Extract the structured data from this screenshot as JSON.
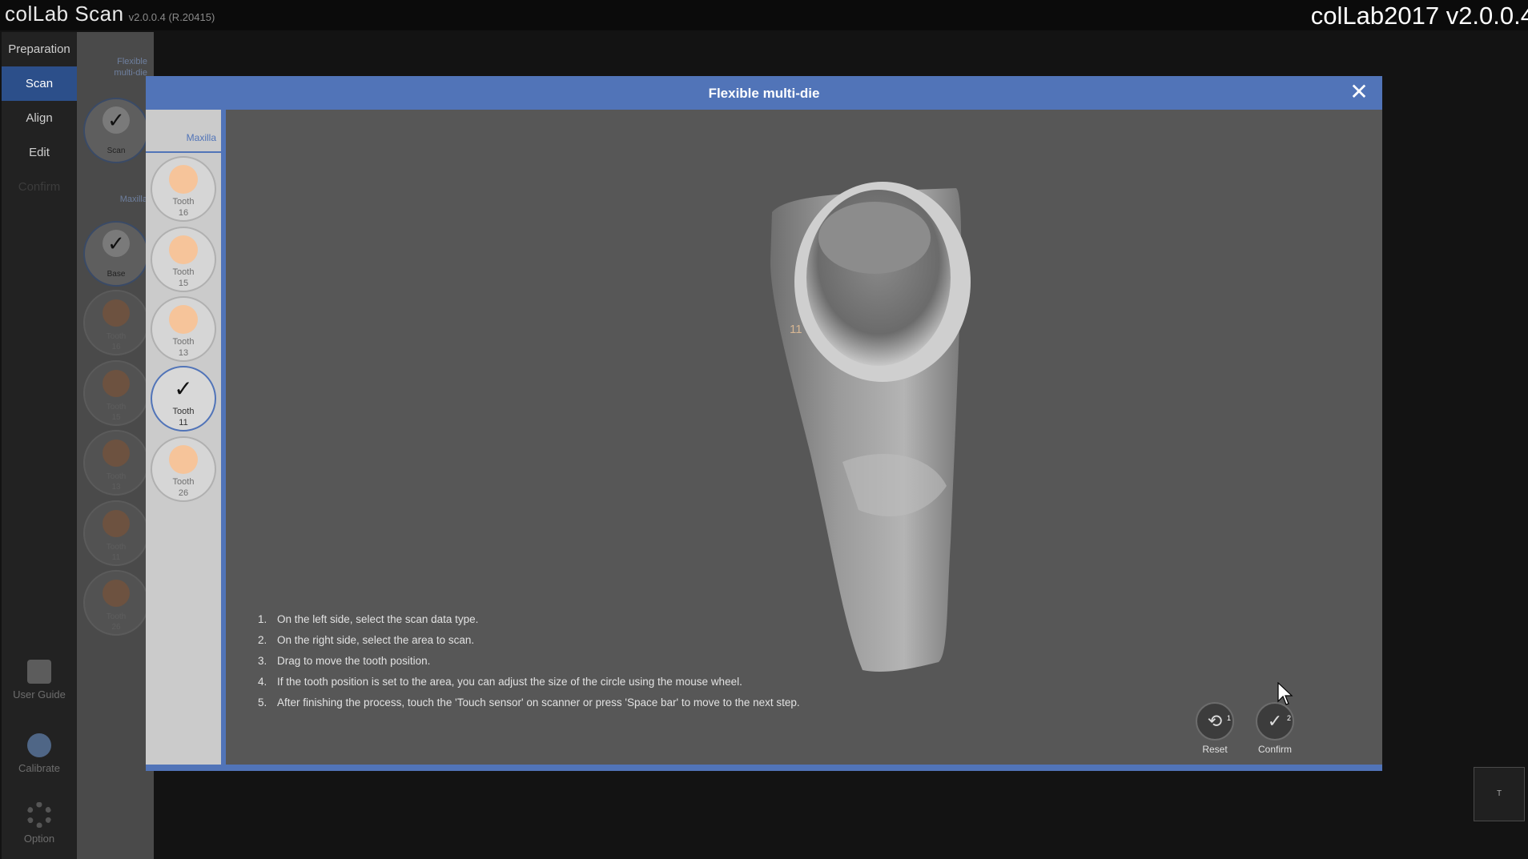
{
  "app": {
    "title": "colLab Scan",
    "version": "v2.0.0.4 (R.20415)",
    "corner_title": "colLab2017 v2.0.0.4"
  },
  "steps": [
    "Preparation",
    "Scan",
    "Align",
    "Edit",
    "Confirm"
  ],
  "side_tools": {
    "user_guide": "User Guide",
    "calibrate": "Calibrate",
    "option": "Option"
  },
  "second_panel": {
    "header_1_line1": "Flexible",
    "header_1_line2": "multi-die",
    "header_2": "Maxilla",
    "items": [
      {
        "label": "Scan",
        "state": "done"
      },
      {
        "label": "Base",
        "state": "done"
      },
      {
        "label": "Tooth",
        "number": "16"
      },
      {
        "label": "Tooth",
        "number": "15"
      },
      {
        "label": "Tooth",
        "number": "13"
      },
      {
        "label": "Tooth",
        "number": "11"
      },
      {
        "label": "Tooth",
        "number": "26"
      }
    ]
  },
  "dialog": {
    "title": "Flexible multi-die",
    "list_header": "Maxilla",
    "teeth": [
      {
        "label": "Tooth",
        "number": "16"
      },
      {
        "label": "Tooth",
        "number": "15"
      },
      {
        "label": "Tooth",
        "number": "13"
      },
      {
        "label": "Tooth",
        "number": "11",
        "selected": true
      },
      {
        "label": "Tooth",
        "number": "26"
      }
    ],
    "model_tag": "11",
    "instructions": [
      {
        "n": "1.",
        "text": "On the left side, select the scan data type."
      },
      {
        "n": "2.",
        "text": "On the right side, select the area to scan."
      },
      {
        "n": "3.",
        "text": "Drag to move the tooth position."
      },
      {
        "n": "4.",
        "text": "If the tooth position is set to the area, you can adjust the size of the circle using the mouse wheel."
      },
      {
        "n": "5.",
        "text": "After finishing the process, touch the 'Touch sensor' on scanner or press 'Space bar' to move to the next step."
      }
    ],
    "reset": {
      "label": "Reset",
      "badge": "1"
    },
    "confirm": {
      "label": "Confirm",
      "badge": "2"
    }
  },
  "viewcube": {
    "label": "T"
  },
  "colors": {
    "accent": "#5174b8",
    "tooth_dot": "#f6c49a",
    "background": "#131313"
  }
}
